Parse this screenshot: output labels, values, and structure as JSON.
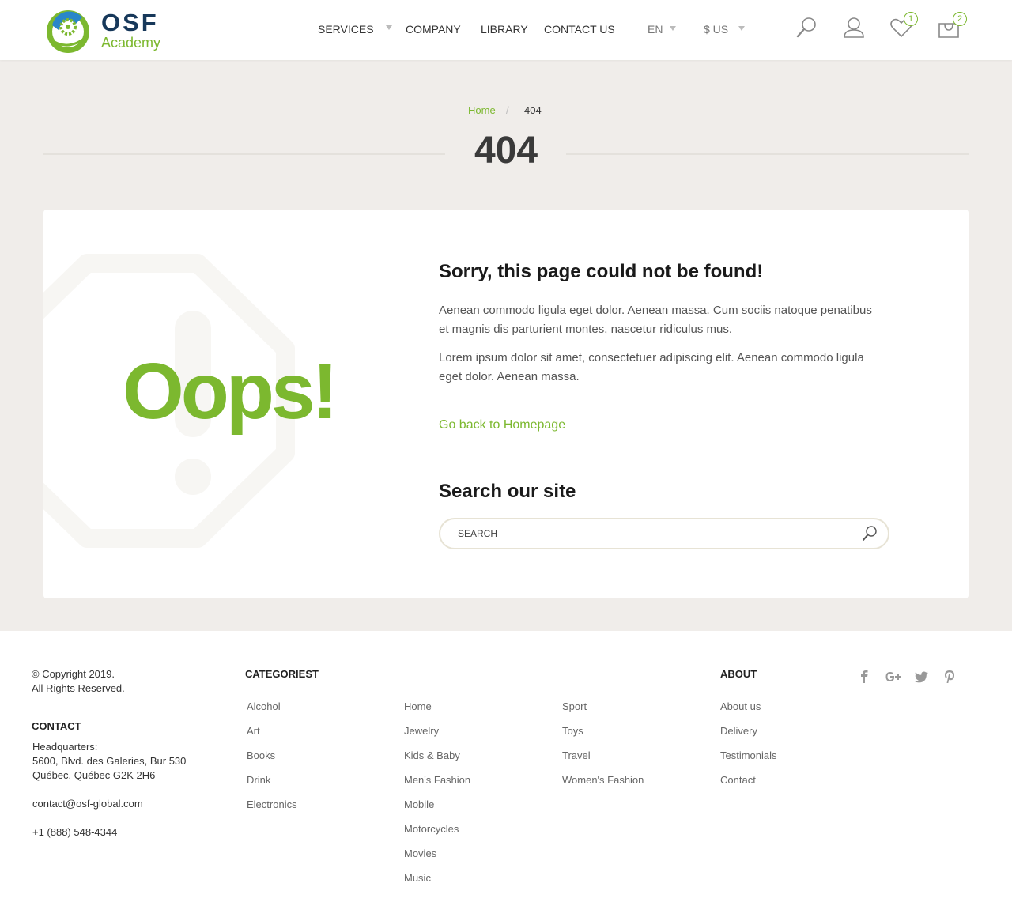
{
  "header": {
    "logo": {
      "name": "OSF",
      "tagline": "Academy"
    },
    "nav": [
      {
        "label": "SERVICES"
      },
      {
        "label": "COMPANY"
      },
      {
        "label": "LIBRARY"
      },
      {
        "label": "CONTACT US"
      }
    ],
    "language": "EN",
    "currency": "$ US",
    "wishlist_count": "1",
    "cart_count": "2",
    "icons": [
      "search-icon",
      "user-icon",
      "heart-icon",
      "bag-icon",
      "chevron-down-icon"
    ]
  },
  "breadcrumb": {
    "home": "Home",
    "separator": "/",
    "current": "404"
  },
  "page_title": "404",
  "error": {
    "oops": "Oops!",
    "heading": "Sorry, this page could not be found!",
    "paragraph1": "Aenean commodo ligula eget dolor. Aenean massa. Cum sociis natoque penatibus et magnis dis parturient montes, nascetur ridiculus mus.",
    "paragraph2": "Lorem ipsum dolor sit amet, consectetuer adipiscing elit. Aenean commodo ligula eget dolor. Aenean massa.",
    "back_link": "Go back to Homepage"
  },
  "search": {
    "heading": "Search our site",
    "placeholder": "SEARCH",
    "value": ""
  },
  "colors": {
    "accent": "#7cb82f",
    "brand_dark": "#17385a",
    "page_bg": "#f0edea"
  },
  "footer": {
    "copyright": "© Copyright 2019.",
    "rights": "All Rights Reserved.",
    "contact_heading": "CONTACT",
    "hq_label": "Headquarters:",
    "address_line1": "5600, Blvd. des Galeries, Bur 530",
    "address_line2": "Québec, Québec G2K 2H6",
    "email": "contact@osf-global.com",
    "phone": "+1 (888) 548-4344",
    "categories_heading": "CATEGORIEST",
    "categories_col1": [
      "Alcohol",
      "Art",
      "Books",
      "Drink",
      "Electronics"
    ],
    "categories_col2": [
      "Home",
      "Jewelry",
      "Kids & Baby",
      "Men's Fashion",
      "Mobile",
      "Motorcycles",
      "Movies",
      "Music"
    ],
    "categories_col3": [
      "Sport",
      "Toys",
      "Travel",
      "Women's Fashion"
    ],
    "about_heading": "ABOUT",
    "about_links": [
      "About us",
      "Delivery",
      "Testimonials",
      "Contact"
    ],
    "social": [
      "facebook-icon",
      "google-plus-icon",
      "twitter-icon",
      "pinterest-icon"
    ]
  }
}
